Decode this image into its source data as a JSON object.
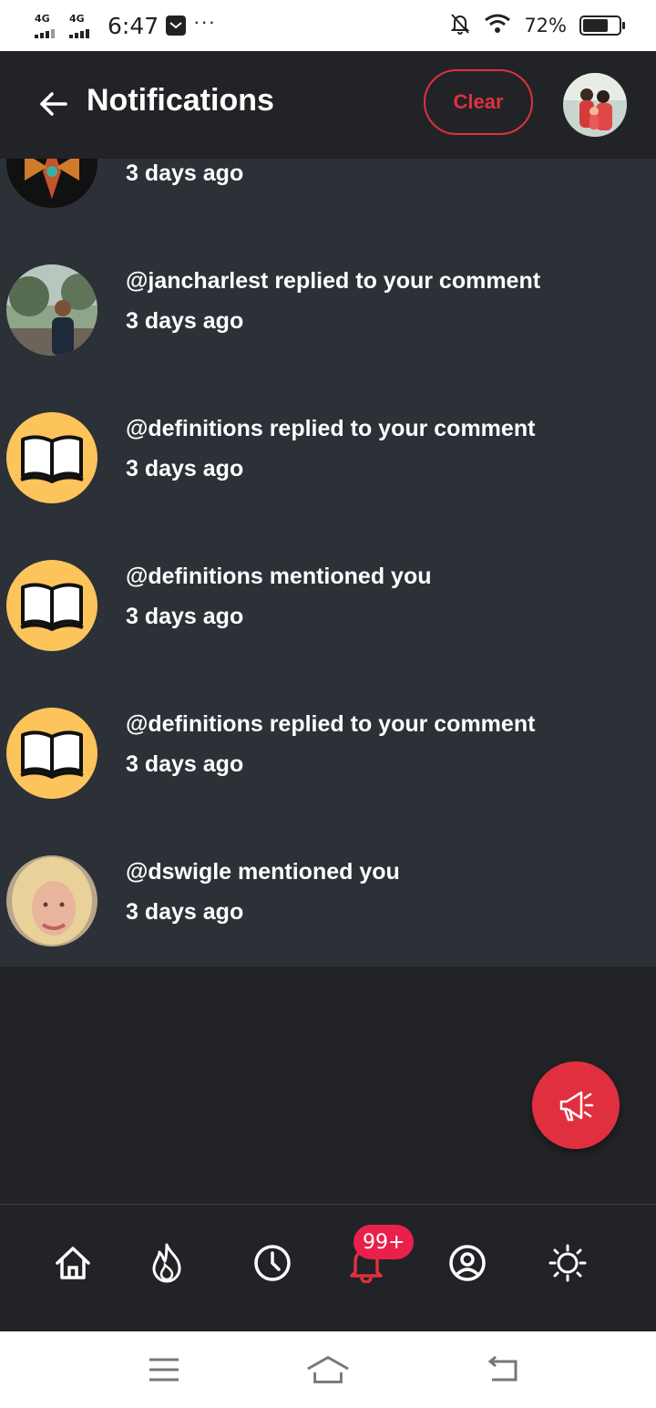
{
  "status_bar": {
    "network_1": "4G",
    "network_2": "4G",
    "time": "6:47",
    "more": "···",
    "battery_percent": "72%",
    "battery_level": 0.72
  },
  "header": {
    "title": "Notifications",
    "clear_label": "Clear"
  },
  "notifications": [
    {
      "text": "",
      "time": "3 days ago",
      "avatar": "dark-tribal-avatar"
    },
    {
      "text": "@jancharlest replied to your comment",
      "time": "3 days ago",
      "avatar": "photo-avatar-man"
    },
    {
      "text": "@definitions replied to your comment",
      "time": "3 days ago",
      "avatar": "book-icon"
    },
    {
      "text": "@definitions mentioned you",
      "time": "3 days ago",
      "avatar": "book-icon"
    },
    {
      "text": "@definitions replied to your comment",
      "time": "3 days ago",
      "avatar": "book-icon"
    },
    {
      "text": "@dswigle mentioned you",
      "time": "3 days ago",
      "avatar": "photo-avatar-woman"
    }
  ],
  "bottom_nav": {
    "items": [
      "home-icon",
      "fire-icon",
      "clock-icon",
      "bell-icon",
      "user-circle-icon",
      "sun-icon"
    ],
    "badge": "99+"
  },
  "colors": {
    "accent": "#e0303f",
    "badge": "#e8204a",
    "book_avatar_bg": "#fdc45c",
    "list_bg": "#2b3137",
    "header_bg": "#222326"
  }
}
